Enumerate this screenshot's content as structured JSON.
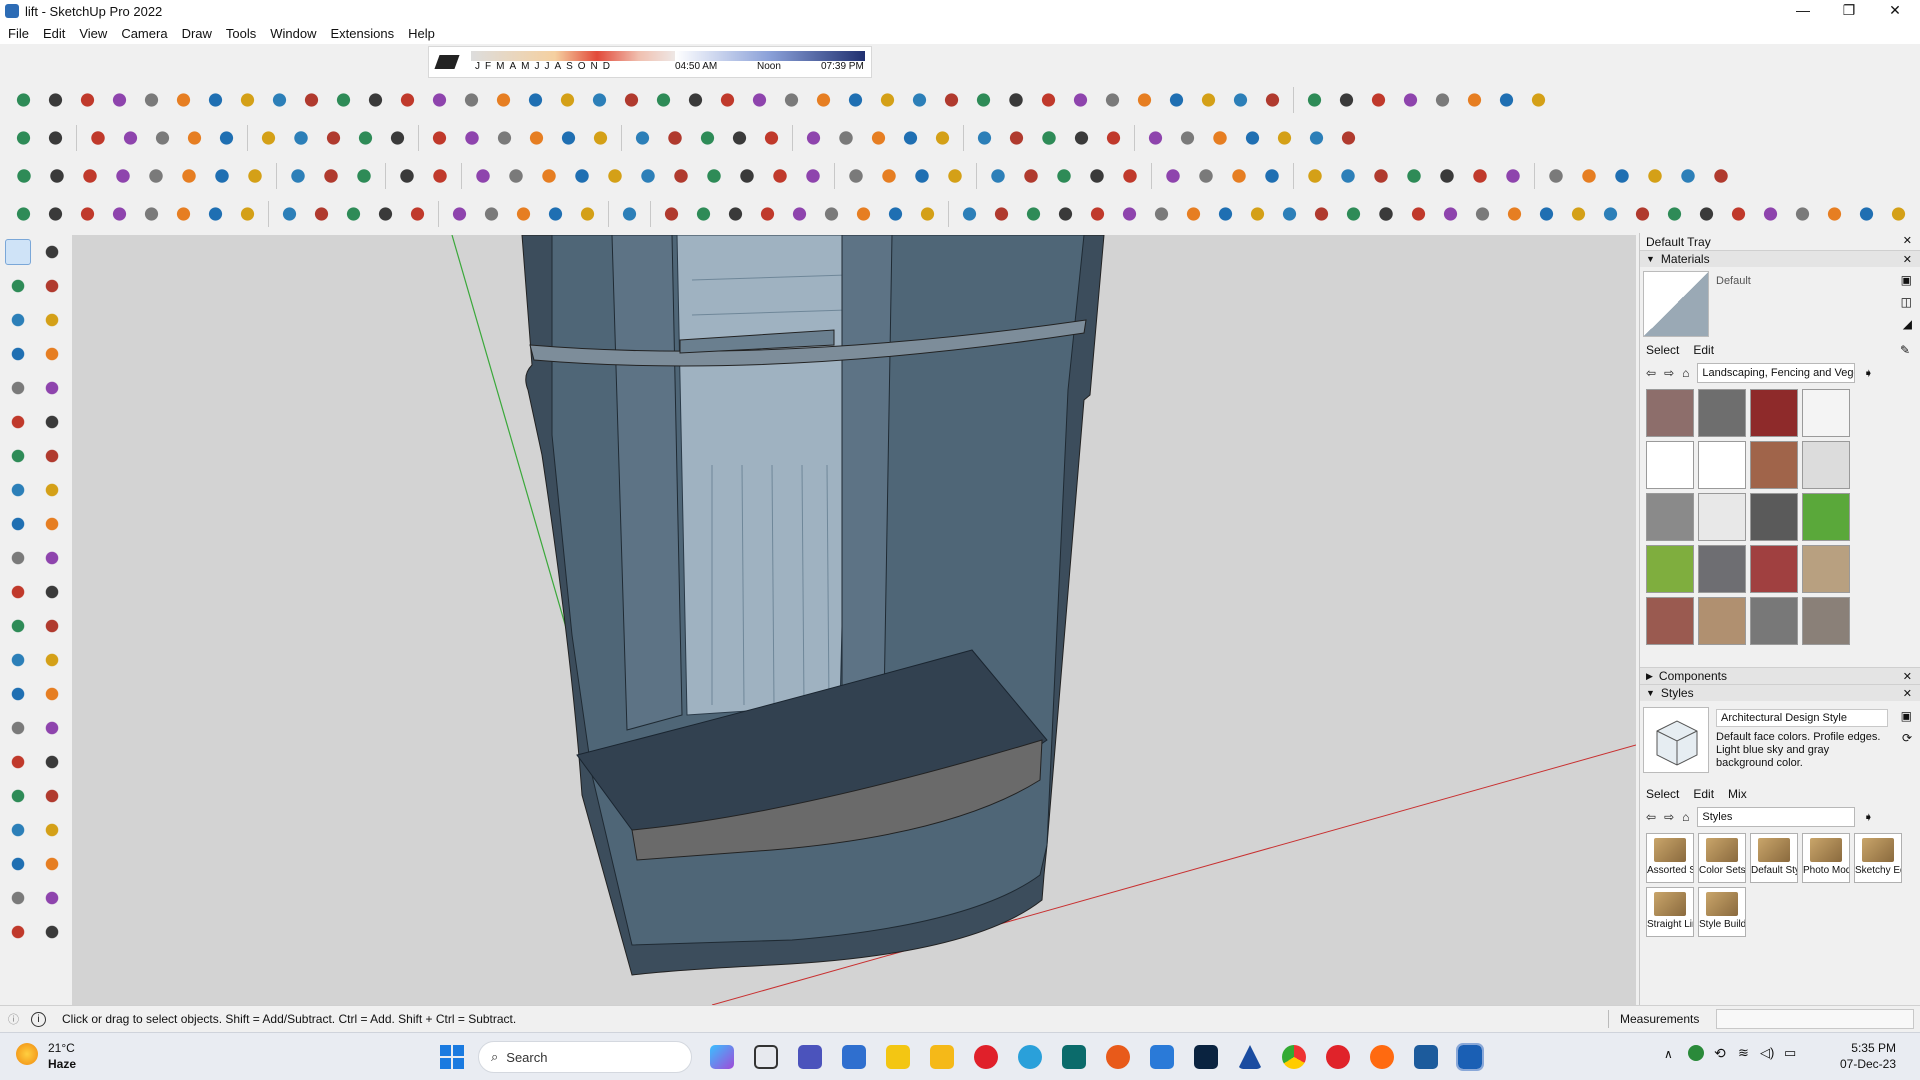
{
  "window": {
    "title": "lift - SketchUp Pro 2022",
    "minimize": "—",
    "maximize": "❐",
    "close": "✕"
  },
  "menu": [
    "File",
    "Edit",
    "View",
    "Camera",
    "Draw",
    "Tools",
    "Window",
    "Extensions",
    "Help"
  ],
  "shadow_bar": {
    "months": "JFMAMJJASOND",
    "time_start": "04:50 AM",
    "time_mid": "Noon",
    "time_end": "07:39 PM"
  },
  "tray": {
    "title": "Default Tray",
    "materials": {
      "header": "Materials",
      "current": "Default",
      "tabs": [
        "Select",
        "Edit"
      ],
      "library": "Landscaping, Fencing and Vegetation",
      "swatches": [
        "#8d6e6b",
        "#6e6e6e",
        "#8e2a2a",
        "#f4f4f4",
        "#ffffff",
        "#ffffff",
        "#a0644a",
        "#dcdcdc",
        "#8a8a8a",
        "#e8e8e8",
        "#5a5a5a",
        "#5aa83a",
        "#7fae3e",
        "#6e6e72",
        "#a04040",
        "#b8a080",
        "#9a5a50",
        "#b09070",
        "#787878",
        "#8a8078"
      ]
    },
    "components": {
      "header": "Components"
    },
    "styles": {
      "header": "Styles",
      "current_name": "Architectural Design Style",
      "current_desc": "Default face colors. Profile edges. Light blue sky and gray background color.",
      "tabs": [
        "Select",
        "Edit",
        "Mix"
      ],
      "library": "Styles",
      "folders": [
        "Assorted Styles",
        "Color Sets",
        "Default Styles",
        "Photo Modeling",
        "Sketchy Edges",
        "Straight Lines",
        "Style Builder"
      ]
    }
  },
  "status": {
    "info_icon": "i",
    "message": "Click or drag to select objects. Shift = Add/Subtract. Ctrl = Add. Shift + Ctrl = Subtract.",
    "measurements_label": "Measurements"
  },
  "taskbar": {
    "weather_temp": "21°C",
    "weather_desc": "Haze",
    "search_placeholder": "Search",
    "time": "5:35 PM",
    "date": "07-Dec-23"
  },
  "colors": {
    "accent": "#0a64c8",
    "viewport_bg": "#d3d3d3",
    "model_face": "#4a5d6e"
  }
}
